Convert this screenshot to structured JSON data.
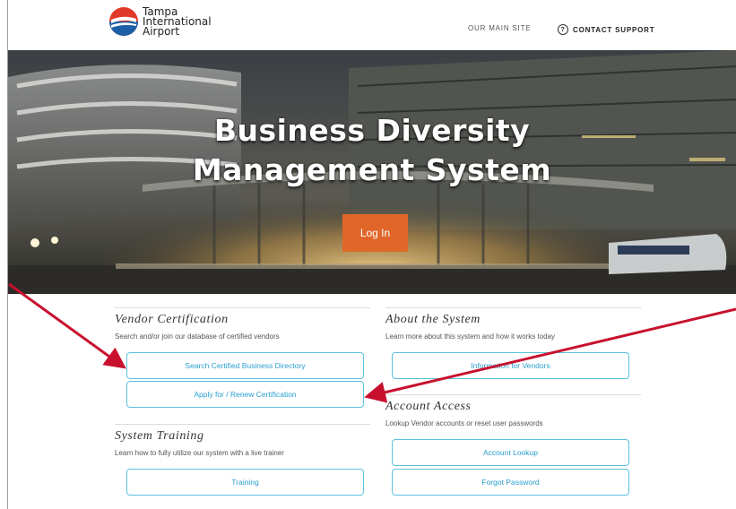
{
  "header": {
    "logo_lines": [
      "Tampa",
      "International",
      "Airport"
    ],
    "nav_main": "OUR MAIN SITE",
    "nav_support": "CONTACT SUPPORT",
    "support_icon_glyph": "?"
  },
  "hero": {
    "title_line1": "Business Diversity",
    "title_line2": "Management System",
    "login_label": "Log In"
  },
  "sections": {
    "vendor_certification": {
      "title": "Vendor Certification",
      "description": "Search and/or join our database of certified vendors",
      "buttons": [
        "Search Certified Business Directory",
        "Apply for / Renew Certification"
      ]
    },
    "system_training": {
      "title": "System Training",
      "description": "Learn how to fully utilize our system with a live trainer",
      "buttons": [
        "Training"
      ]
    },
    "about_system": {
      "title": "About the System",
      "description": "Learn more about this system and how it works today",
      "buttons": [
        "Information for Vendors"
      ]
    },
    "account_access": {
      "title": "Account Access",
      "description": "Lookup Vendor accounts or reset user passwords",
      "buttons": [
        "Account Lookup",
        "Forgot Password"
      ]
    }
  },
  "colors": {
    "accent_button": "#5bc1de",
    "login_orange": "#e0662a",
    "annotation_arrow": "#c8102e"
  }
}
